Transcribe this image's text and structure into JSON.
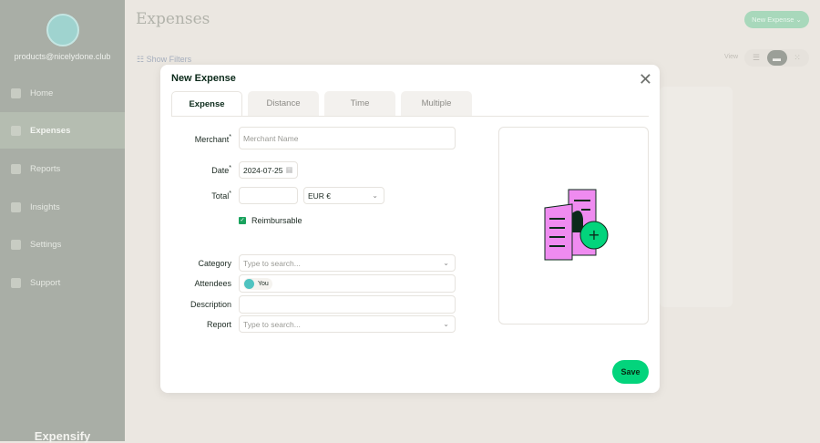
{
  "sidebar": {
    "email": "products@nicelydone.club",
    "items": [
      {
        "label": "Home"
      },
      {
        "label": "Expenses"
      },
      {
        "label": "Reports"
      },
      {
        "label": "Insights"
      },
      {
        "label": "Settings"
      },
      {
        "label": "Support"
      }
    ],
    "brand": "Expensify"
  },
  "header": {
    "title": "Expenses",
    "new_expense": "New Expense ⌄",
    "show_filters": "Show Filters",
    "view_label": "View"
  },
  "modal": {
    "title": "New Expense",
    "close": "✕",
    "tabs": [
      {
        "label": "Expense"
      },
      {
        "label": "Distance"
      },
      {
        "label": "Time"
      },
      {
        "label": "Multiple"
      }
    ],
    "fields": {
      "merchant_label": "Merchant",
      "merchant_placeholder": "Merchant Name",
      "date_label": "Date",
      "date_value": "2024-07-25",
      "total_label": "Total",
      "currency": "EUR €",
      "reimbursable": "Reimbursable",
      "category_label": "Category",
      "category_placeholder": "Type to search...",
      "attendees_label": "Attendees",
      "attendee": "You",
      "description_label": "Description",
      "report_label": "Report",
      "report_placeholder": "Type to search...",
      "required": "*"
    },
    "save": "Save"
  }
}
